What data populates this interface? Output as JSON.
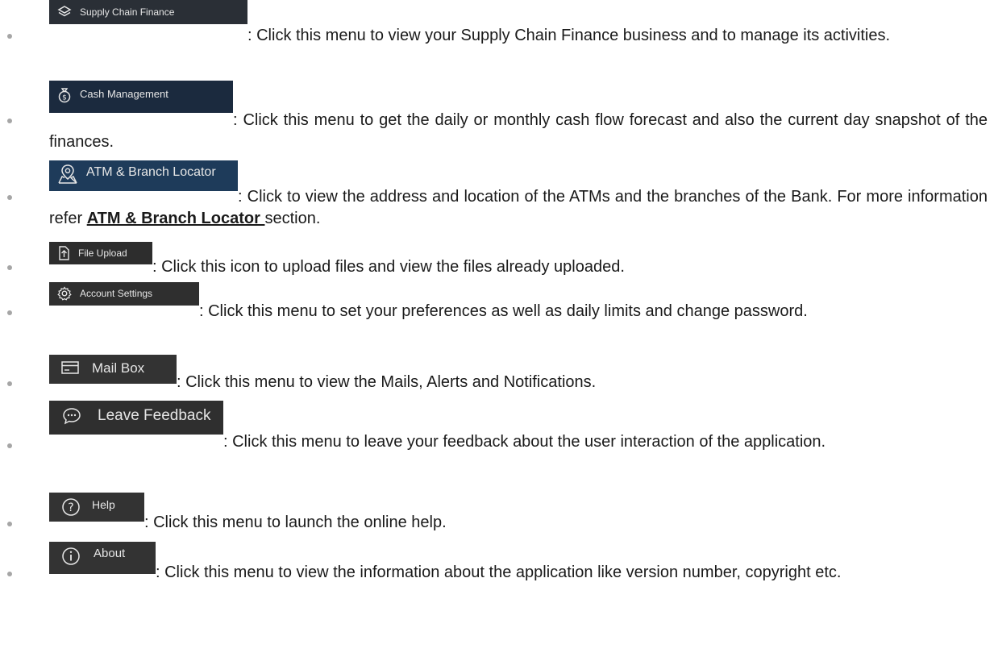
{
  "items": [
    {
      "menu_label": "Supply Chain Finance",
      "icon": "layers-icon",
      "bg": "#2a2f36",
      "text": ": Click this menu to view your Supply Chain Finance business and to manage its activities."
    },
    {
      "menu_label": "Cash Management",
      "icon": "money-bag-icon",
      "bg": "#1b2a3e",
      "text": ": Click this menu to get the daily or monthly cash flow forecast and also the current day snapshot of the finances."
    },
    {
      "menu_label": "ATM & Branch Locator",
      "icon": "map-pin-icon",
      "bg": "#1e3b5a",
      "text_before": ": Click to view the address and location of the ATMs and the branches of the Bank. For more information refer ",
      "link": "ATM & Branch Locator ",
      "text_after": "section."
    },
    {
      "menu_label": "File Upload",
      "icon": "file-upload-icon",
      "bg": "#2d2d2d",
      "text": ": Click this icon to upload files and view the files already uploaded."
    },
    {
      "menu_label": "Account Settings",
      "icon": "gear-icon",
      "bg": "#2f2f2f",
      "text": ": Click this menu to set your preferences as well as daily limits and change password."
    },
    {
      "menu_label": "Mail Box",
      "icon": "mailbox-icon",
      "bg": "#333333",
      "text": ": Click this menu to view the Mails, Alerts and Notifications."
    },
    {
      "menu_label": "Leave Feedback",
      "icon": "chat-bubble-icon",
      "bg": "#2f2f2f",
      "text": ": Click this menu to leave your feedback about the user interaction of the application."
    },
    {
      "menu_label": "Help",
      "icon": "help-circle-icon",
      "bg": "#333333",
      "text": ": Click this menu to launch the online help."
    },
    {
      "menu_label": "About",
      "icon": "info-circle-icon",
      "bg": "#333333",
      "text": ": Click this menu to view the information about the application like version number, copyright etc."
    }
  ]
}
